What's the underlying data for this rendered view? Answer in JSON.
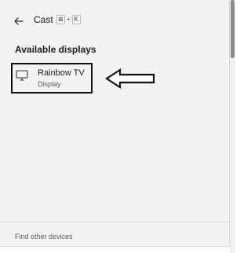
{
  "header": {
    "title": "Cast",
    "shortcut": {
      "key1": "⊞",
      "plus": "+",
      "key2": "K"
    }
  },
  "displays": {
    "heading": "Available displays",
    "items": [
      {
        "name": "Rainbow TV",
        "type": "Display",
        "icon": "monitor-icon"
      }
    ]
  },
  "footer": {
    "find_link": "Find other devices"
  },
  "colors": {
    "panel_bg": "#f3f3f3",
    "highlight_border": "#111111"
  }
}
